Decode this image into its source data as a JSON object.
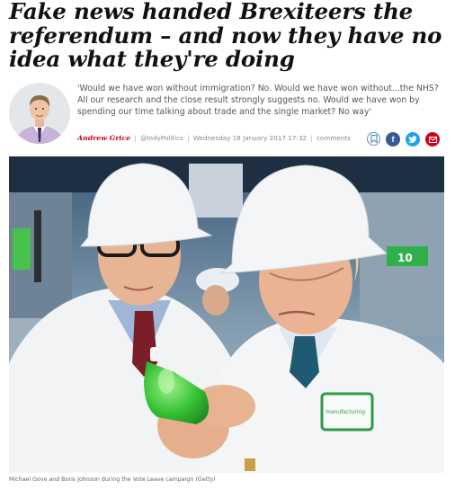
{
  "article": {
    "headline": "Fake news handed Brexiteers the referendum – and now they have no idea what they're doing",
    "standfirst": "'Would we have won without immigration? No. Would we have won without...the NHS? All our research and the close result strongly suggests no. Would we have won by spending our time talking about trade and the single market? No way'",
    "author": "Andrew Grice",
    "twitter_handle": "@IndyPolitics",
    "date": "Wednesday 18 January 2017 17:32",
    "comments_label": "comments"
  },
  "image": {
    "caption": "Michael Gove and Boris Johnson during the Vote Leave campaign",
    "credit": "(Getty)",
    "badge_text": "manufacturing",
    "wall_sign": "10"
  },
  "share": {
    "icons": [
      "bookmark-icon",
      "facebook-icon",
      "twitter-icon",
      "email-icon"
    ]
  },
  "colors": {
    "author_red": "#d0021b",
    "facebook": "#3b5998",
    "twitter": "#1da1f2",
    "email": "#d0021b",
    "bookmark": "#5b8fb5"
  }
}
